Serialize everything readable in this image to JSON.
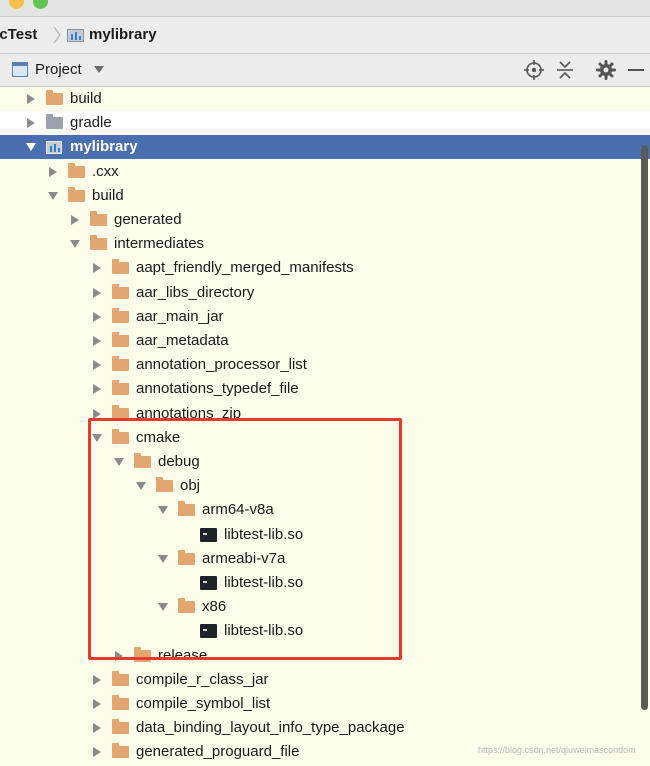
{
  "window": {
    "traffic_lights": [
      "#f5bf4f",
      "#61c454"
    ]
  },
  "breadcrumb": {
    "items": [
      {
        "label": "ccTest",
        "icon": "none"
      },
      {
        "label": "mylibrary",
        "icon": "module-icon"
      }
    ]
  },
  "toolbar": {
    "view_label": "Project",
    "icons": [
      "locate-icon",
      "collapse-all-icon",
      "gear-icon",
      "minimize-icon"
    ]
  },
  "tree": {
    "items": [
      {
        "label": "build",
        "level": 0,
        "arrow": "right",
        "icon": "folder"
      },
      {
        "label": "gradle",
        "level": 0,
        "arrow": "right",
        "icon": "folder-gray",
        "bg": "white"
      },
      {
        "label": "mylibrary",
        "level": 0,
        "arrow": "down",
        "icon": "module",
        "selected": true
      },
      {
        "label": ".cxx",
        "level": 1,
        "arrow": "right",
        "icon": "folder"
      },
      {
        "label": "build",
        "level": 1,
        "arrow": "down",
        "icon": "folder"
      },
      {
        "label": "generated",
        "level": 2,
        "arrow": "right",
        "icon": "folder"
      },
      {
        "label": "intermediates",
        "level": 2,
        "arrow": "down",
        "icon": "folder"
      },
      {
        "label": "aapt_friendly_merged_manifests",
        "level": 3,
        "arrow": "right",
        "icon": "folder"
      },
      {
        "label": "aar_libs_directory",
        "level": 3,
        "arrow": "right",
        "icon": "folder"
      },
      {
        "label": "aar_main_jar",
        "level": 3,
        "arrow": "right",
        "icon": "folder"
      },
      {
        "label": "aar_metadata",
        "level": 3,
        "arrow": "right",
        "icon": "folder"
      },
      {
        "label": "annotation_processor_list",
        "level": 3,
        "arrow": "right",
        "icon": "folder"
      },
      {
        "label": "annotations_typedef_file",
        "level": 3,
        "arrow": "right",
        "icon": "folder"
      },
      {
        "label": "annotations_zip",
        "level": 3,
        "arrow": "right",
        "icon": "folder"
      },
      {
        "label": "cmake",
        "level": 3,
        "arrow": "down",
        "icon": "folder"
      },
      {
        "label": "debug",
        "level": 4,
        "arrow": "down",
        "icon": "folder"
      },
      {
        "label": "obj",
        "level": 5,
        "arrow": "down",
        "icon": "folder"
      },
      {
        "label": "arm64-v8a",
        "level": 6,
        "arrow": "down",
        "icon": "folder"
      },
      {
        "label": "libtest-lib.so",
        "level": 7,
        "arrow": "none",
        "icon": "so"
      },
      {
        "label": "armeabi-v7a",
        "level": 6,
        "arrow": "down",
        "icon": "folder"
      },
      {
        "label": "libtest-lib.so",
        "level": 7,
        "arrow": "none",
        "icon": "so"
      },
      {
        "label": "x86",
        "level": 6,
        "arrow": "down",
        "icon": "folder"
      },
      {
        "label": "libtest-lib.so",
        "level": 7,
        "arrow": "none",
        "icon": "so"
      },
      {
        "label": "release",
        "level": 4,
        "arrow": "right",
        "icon": "folder"
      },
      {
        "label": "compile_r_class_jar",
        "level": 3,
        "arrow": "right",
        "icon": "folder"
      },
      {
        "label": "compile_symbol_list",
        "level": 3,
        "arrow": "right",
        "icon": "folder"
      },
      {
        "label": "data_binding_layout_info_type_package",
        "level": 3,
        "arrow": "right",
        "icon": "folder"
      },
      {
        "label": "generated_proguard_file",
        "level": 3,
        "arrow": "right",
        "icon": "folder"
      }
    ]
  },
  "colors": {
    "panel_bg": "#fdfcea",
    "selection": "#4a6fb0",
    "folder": "#e3a670",
    "highlight_box": "#e53b2c"
  },
  "watermark": "https://blog.csdn.net/qiuweimascondom"
}
